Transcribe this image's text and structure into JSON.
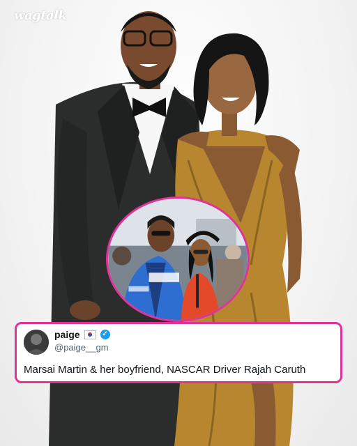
{
  "brand": {
    "logo_text": "wagtalk"
  },
  "tweet": {
    "display_name": "paige",
    "flag_icon": "south-korea-flag-icon",
    "verified_icon": "verified-badge-icon",
    "handle": "@paige__gm",
    "text": "Marsai Martin & her boyfriend, NASCAR Driver Rajah Caruth"
  },
  "colors": {
    "accent_border": "#e0339a",
    "verified": "#1d9bf0",
    "gold_dress": "#b8862e",
    "tuxedo": "#2b2d2c"
  }
}
